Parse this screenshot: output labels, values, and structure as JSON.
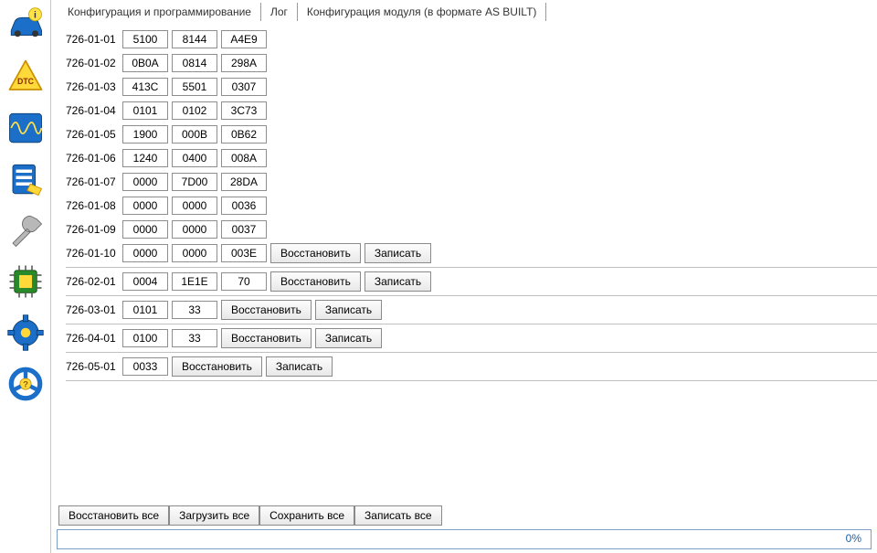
{
  "tabs": {
    "config": "Конфигурация и программирование",
    "log": "Лог",
    "asbuilt": "Конфигурация модуля (в формате AS BUILT)"
  },
  "buttons": {
    "restore": "Восстановить",
    "write": "Записать",
    "restore_all": "Восстановить все",
    "load_all": "Загрузить все",
    "save_all": "Сохранить все",
    "write_all": "Записать все"
  },
  "progress": "0%",
  "blocks": [
    {
      "rows": [
        {
          "addr": "726-01-01",
          "v": [
            "5100",
            "8144",
            "A4E9"
          ]
        },
        {
          "addr": "726-01-02",
          "v": [
            "0B0A",
            "0814",
            "298A"
          ]
        },
        {
          "addr": "726-01-03",
          "v": [
            "413C",
            "5501",
            "0307"
          ]
        },
        {
          "addr": "726-01-04",
          "v": [
            "0101",
            "0102",
            "3C73"
          ]
        },
        {
          "addr": "726-01-05",
          "v": [
            "1900",
            "000B",
            "0B62"
          ]
        },
        {
          "addr": "726-01-06",
          "v": [
            "1240",
            "0400",
            "008A"
          ]
        },
        {
          "addr": "726-01-07",
          "v": [
            "0000",
            "7D00",
            "28DA"
          ]
        },
        {
          "addr": "726-01-08",
          "v": [
            "0000",
            "0000",
            "0036"
          ]
        },
        {
          "addr": "726-01-09",
          "v": [
            "0000",
            "0000",
            "0037"
          ]
        },
        {
          "addr": "726-01-10",
          "v": [
            "0000",
            "0000",
            "003E"
          ],
          "actions": true
        }
      ]
    },
    {
      "rows": [
        {
          "addr": "726-02-01",
          "v": [
            "0004",
            "1E1E",
            "70"
          ],
          "actions": true
        }
      ]
    },
    {
      "rows": [
        {
          "addr": "726-03-01",
          "v": [
            "0101",
            "33"
          ],
          "actions": true
        }
      ]
    },
    {
      "rows": [
        {
          "addr": "726-04-01",
          "v": [
            "0100",
            "33"
          ],
          "actions": true
        }
      ]
    },
    {
      "rows": [
        {
          "addr": "726-05-01",
          "v": [
            "0033"
          ],
          "actions": true
        }
      ]
    }
  ]
}
